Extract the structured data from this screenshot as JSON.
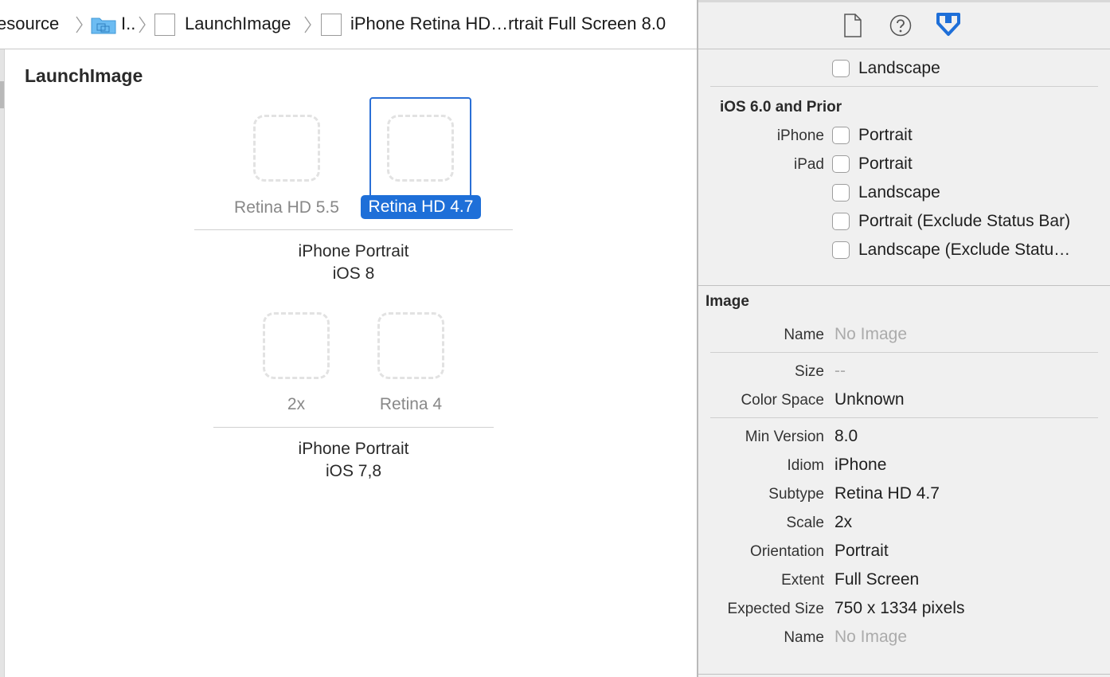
{
  "breadcrumb": {
    "items": [
      {
        "label": "esource"
      },
      {
        "label": "I.."
      },
      {
        "label": "LaunchImage"
      },
      {
        "label": "iPhone Retina HD…rtrait Full Screen 8.0"
      }
    ]
  },
  "editor": {
    "title": "LaunchImage",
    "groups": [
      {
        "slots": [
          {
            "label": "Retina HD 5.5",
            "selected": false
          },
          {
            "label": "Retina HD 4.7",
            "selected": true
          }
        ],
        "caption_line1": "iPhone Portrait",
        "caption_line2": "iOS 8"
      },
      {
        "slots": [
          {
            "label": "2x",
            "selected": false
          },
          {
            "label": "Retina 4",
            "selected": false
          }
        ],
        "caption_line1": "iPhone Portrait",
        "caption_line2": "iOS 7,8"
      }
    ]
  },
  "inspector": {
    "tabs": [
      {
        "icon": "file-icon"
      },
      {
        "icon": "help-icon"
      },
      {
        "icon": "attributes-icon",
        "active": true
      }
    ],
    "top_checkbox": {
      "label": "Landscape",
      "checked": false
    },
    "ios6": {
      "header": "iOS 6.0 and Prior",
      "rows": [
        {
          "key": "iPhone",
          "label": "Portrait",
          "checked": false
        },
        {
          "key": "iPad",
          "label": "Portrait",
          "checked": false
        },
        {
          "key": "",
          "label": "Landscape",
          "checked": false
        },
        {
          "key": "",
          "label": "Portrait (Exclude Status Bar)",
          "checked": false
        },
        {
          "key": "",
          "label": "Landscape (Exclude Statu…",
          "checked": false
        }
      ]
    },
    "image": {
      "header": "Image",
      "name_key": "Name",
      "name_value": "No Image",
      "size_key": "Size",
      "size_value": "--",
      "colorspace_key": "Color Space",
      "colorspace_value": "Unknown",
      "minversion_key": "Min Version",
      "minversion_value": "8.0",
      "idiom_key": "Idiom",
      "idiom_value": "iPhone",
      "subtype_key": "Subtype",
      "subtype_value": "Retina HD 4.7",
      "scale_key": "Scale",
      "scale_value": "2x",
      "orientation_key": "Orientation",
      "orientation_value": "Portrait",
      "extent_key": "Extent",
      "extent_value": "Full Screen",
      "expected_key": "Expected Size",
      "expected_value": "750 x 1334 pixels",
      "name2_key": "Name",
      "name2_value": "No Image"
    }
  },
  "colors": {
    "accent": "#1e6fd8",
    "folder": "#5fb3ef"
  }
}
